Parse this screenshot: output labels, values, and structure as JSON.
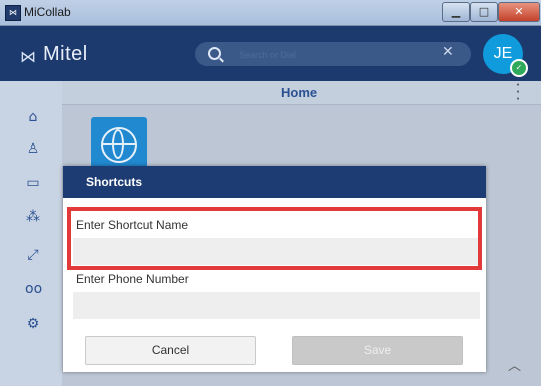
{
  "window": {
    "title": "MiCollab",
    "icon": "mitel-app-icon",
    "controls": [
      "minimize",
      "maximize",
      "close"
    ]
  },
  "header": {
    "brand": "Mitel",
    "search_placeholder": "Search or Dial",
    "avatar_initials": "JE",
    "presence": "available",
    "brand_color": "#1c3a6e"
  },
  "sidebar": {
    "items": [
      {
        "icon": "home-icon",
        "glyph": "⌂"
      },
      {
        "icon": "contact-icon",
        "glyph": "♙"
      },
      {
        "icon": "chat-icon",
        "glyph": "▭"
      },
      {
        "icon": "conference-icon",
        "glyph": "⁂"
      },
      {
        "icon": "calls-icon",
        "glyph": "⤢"
      },
      {
        "icon": "voicemail-icon",
        "glyph": "oo"
      },
      {
        "icon": "settings-icon",
        "glyph": "⚙"
      }
    ]
  },
  "main": {
    "page_title": "Home"
  },
  "dialog": {
    "title": "Shortcuts",
    "name_label": "Enter Shortcut Name",
    "name_value": "",
    "phone_label": "Enter Phone Number",
    "phone_value": "",
    "cancel_label": "Cancel",
    "save_label": "Save",
    "highlight_color": "#e23a3a"
  }
}
